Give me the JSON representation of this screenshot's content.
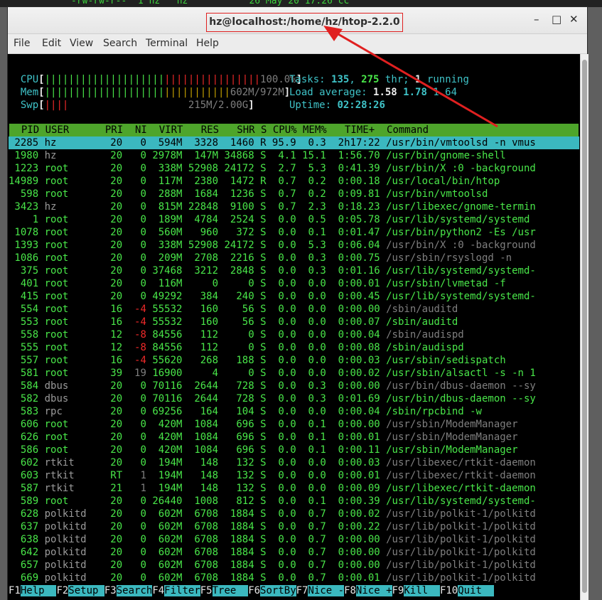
{
  "background_terminal": {
    "peek_text": "-rw-rw-r--  1 hz   hz           26 May 20 17:26 cc"
  },
  "window": {
    "title": "hz@localhost:/home/hz/htop-2.2.0",
    "buttons": {
      "minimize": "–",
      "maximize": "□",
      "close": "✕"
    }
  },
  "menubar": {
    "items": [
      "File",
      "Edit",
      "View",
      "Search",
      "Terminal",
      "Help"
    ]
  },
  "meters": {
    "cpu": {
      "label": "CPU",
      "bars_green": "||||||||||||||||||||",
      "bars_red": "||||||||||||||||",
      "value": "100.0%"
    },
    "mem": {
      "label": "Mem",
      "bars_green": "||||||||||||||||||||",
      "bars_yellow": "|||||||||||",
      "value": "602M/972M"
    },
    "swp": {
      "label": "Swp",
      "bars_red": "||||",
      "value": "215M/2.00G"
    }
  },
  "summary": {
    "tasks_label": "Tasks: ",
    "tasks_count": "135",
    "thr_count": "275",
    "thr_label": " thr; ",
    "running_count": "1",
    "running_label": " running",
    "load_label": "Load average: ",
    "load_1": "1.58",
    "load_5": "1.78",
    "load_15": "1.64",
    "uptime_label": "Uptime: ",
    "uptime_value": "02:28:26"
  },
  "columns": {
    "header": "  PID USER      PRI  NI  VIRT   RES   SHR S CPU% MEM%   TIME+  Command"
  },
  "processes": [
    {
      "pid": "2285",
      "user": "hz",
      "pri": "20",
      "ni": "0",
      "virt": "594M",
      "res": "3328",
      "shr": "1460",
      "s": "R",
      "cpu": "95.9",
      "mem": "0.3",
      "time": "2h17:22",
      "cmd": "/usr/bin/vmtoolsd -n vmus",
      "selected": true
    },
    {
      "pid": "1980",
      "user": "hz",
      "pri": "20",
      "ni": "0",
      "virt": "2978M",
      "res": "147M",
      "shr": "34868",
      "s": "S",
      "cpu": "4.1",
      "mem": "15.1",
      "time": "1:56.70",
      "cmd": "/usr/bin/gnome-shell"
    },
    {
      "pid": "1223",
      "user": "root",
      "pri": "20",
      "ni": "0",
      "virt": "338M",
      "res": "52908",
      "shr": "24172",
      "s": "S",
      "cpu": "2.7",
      "mem": "5.3",
      "time": "0:41.39",
      "cmd": "/usr/bin/X :0 -background"
    },
    {
      "pid": "14989",
      "user": "root",
      "pri": "20",
      "ni": "0",
      "virt": "117M",
      "res": "2380",
      "shr": "1472",
      "s": "R",
      "cpu": "0.7",
      "mem": "0.2",
      "time": "0:00.18",
      "cmd": "/usr/local/bin/htop"
    },
    {
      "pid": "598",
      "user": "root",
      "pri": "20",
      "ni": "0",
      "virt": "288M",
      "res": "1684",
      "shr": "1236",
      "s": "S",
      "cpu": "0.7",
      "mem": "0.2",
      "time": "0:09.81",
      "cmd": "/usr/bin/vmtoolsd"
    },
    {
      "pid": "3423",
      "user": "hz",
      "pri": "20",
      "ni": "0",
      "virt": "815M",
      "res": "22848",
      "shr": "9100",
      "s": "S",
      "cpu": "0.7",
      "mem": "2.3",
      "time": "0:18.23",
      "cmd": "/usr/libexec/gnome-termin"
    },
    {
      "pid": "1",
      "user": "root",
      "pri": "20",
      "ni": "0",
      "virt": "189M",
      "res": "4784",
      "shr": "2524",
      "s": "S",
      "cpu": "0.0",
      "mem": "0.5",
      "time": "0:05.78",
      "cmd": "/usr/lib/systemd/systemd"
    },
    {
      "pid": "1078",
      "user": "root",
      "pri": "20",
      "ni": "0",
      "virt": "560M",
      "res": "960",
      "shr": "372",
      "s": "S",
      "cpu": "0.0",
      "mem": "0.1",
      "time": "0:01.47",
      "cmd": "/usr/bin/python2 -Es /usr"
    },
    {
      "pid": "1393",
      "user": "root",
      "pri": "20",
      "ni": "0",
      "virt": "338M",
      "res": "52908",
      "shr": "24172",
      "s": "S",
      "cpu": "0.0",
      "mem": "5.3",
      "time": "0:06.04",
      "cmd": "/usr/bin/X :0 -background",
      "dim_cmd": true
    },
    {
      "pid": "1086",
      "user": "root",
      "pri": "20",
      "ni": "0",
      "virt": "209M",
      "res": "2708",
      "shr": "2216",
      "s": "S",
      "cpu": "0.0",
      "mem": "0.3",
      "time": "0:00.75",
      "cmd": "/usr/sbin/rsyslogd -n",
      "dim_cmd": true
    },
    {
      "pid": "375",
      "user": "root",
      "pri": "20",
      "ni": "0",
      "virt": "37468",
      "res": "3212",
      "shr": "2848",
      "s": "S",
      "cpu": "0.0",
      "mem": "0.3",
      "time": "0:01.16",
      "cmd": "/usr/lib/systemd/systemd-"
    },
    {
      "pid": "401",
      "user": "root",
      "pri": "20",
      "ni": "0",
      "virt": "116M",
      "res": "0",
      "shr": "0",
      "s": "S",
      "cpu": "0.0",
      "mem": "0.0",
      "time": "0:00.01",
      "cmd": "/usr/sbin/lvmetad -f"
    },
    {
      "pid": "415",
      "user": "root",
      "pri": "20",
      "ni": "0",
      "virt": "49292",
      "res": "384",
      "shr": "240",
      "s": "S",
      "cpu": "0.0",
      "mem": "0.0",
      "time": "0:00.45",
      "cmd": "/usr/lib/systemd/systemd-"
    },
    {
      "pid": "554",
      "user": "root",
      "pri": "16",
      "ni": "-4",
      "virt": "55532",
      "res": "160",
      "shr": "56",
      "s": "S",
      "cpu": "0.0",
      "mem": "0.0",
      "time": "0:00.00",
      "cmd": "/sbin/auditd",
      "dim_cmd": true
    },
    {
      "pid": "553",
      "user": "root",
      "pri": "16",
      "ni": "-4",
      "virt": "55532",
      "res": "160",
      "shr": "56",
      "s": "S",
      "cpu": "0.0",
      "mem": "0.0",
      "time": "0:00.07",
      "cmd": "/sbin/auditd"
    },
    {
      "pid": "558",
      "user": "root",
      "pri": "12",
      "ni": "-8",
      "virt": "84556",
      "res": "112",
      "shr": "0",
      "s": "S",
      "cpu": "0.0",
      "mem": "0.0",
      "time": "0:00.04",
      "cmd": "/sbin/audispd",
      "dim_cmd": true
    },
    {
      "pid": "555",
      "user": "root",
      "pri": "12",
      "ni": "-8",
      "virt": "84556",
      "res": "112",
      "shr": "0",
      "s": "S",
      "cpu": "0.0",
      "mem": "0.0",
      "time": "0:00.08",
      "cmd": "/sbin/audispd"
    },
    {
      "pid": "557",
      "user": "root",
      "pri": "16",
      "ni": "-4",
      "virt": "55620",
      "res": "268",
      "shr": "188",
      "s": "S",
      "cpu": "0.0",
      "mem": "0.0",
      "time": "0:00.03",
      "cmd": "/usr/sbin/sedispatch"
    },
    {
      "pid": "581",
      "user": "root",
      "pri": "39",
      "ni": "19",
      "virt": "16900",
      "res": "4",
      "shr": "0",
      "s": "S",
      "cpu": "0.0",
      "mem": "0.0",
      "time": "0:00.02",
      "cmd": "/usr/sbin/alsactl -s -n 1"
    },
    {
      "pid": "584",
      "user": "dbus",
      "pri": "20",
      "ni": "0",
      "virt": "70116",
      "res": "2644",
      "shr": "728",
      "s": "S",
      "cpu": "0.0",
      "mem": "0.3",
      "time": "0:00.00",
      "cmd": "/usr/bin/dbus-daemon --sy",
      "dim_cmd": true
    },
    {
      "pid": "582",
      "user": "dbus",
      "pri": "20",
      "ni": "0",
      "virt": "70116",
      "res": "2644",
      "shr": "728",
      "s": "S",
      "cpu": "0.0",
      "mem": "0.3",
      "time": "0:01.69",
      "cmd": "/usr/bin/dbus-daemon --sy"
    },
    {
      "pid": "583",
      "user": "rpc",
      "pri": "20",
      "ni": "0",
      "virt": "69256",
      "res": "164",
      "shr": "104",
      "s": "S",
      "cpu": "0.0",
      "mem": "0.0",
      "time": "0:00.04",
      "cmd": "/sbin/rpcbind -w"
    },
    {
      "pid": "606",
      "user": "root",
      "pri": "20",
      "ni": "0",
      "virt": "420M",
      "res": "1084",
      "shr": "696",
      "s": "S",
      "cpu": "0.0",
      "mem": "0.1",
      "time": "0:00.00",
      "cmd": "/usr/sbin/ModemManager",
      "dim_cmd": true
    },
    {
      "pid": "626",
      "user": "root",
      "pri": "20",
      "ni": "0",
      "virt": "420M",
      "res": "1084",
      "shr": "696",
      "s": "S",
      "cpu": "0.0",
      "mem": "0.1",
      "time": "0:00.01",
      "cmd": "/usr/sbin/ModemManager",
      "dim_cmd": true
    },
    {
      "pid": "586",
      "user": "root",
      "pri": "20",
      "ni": "0",
      "virt": "420M",
      "res": "1084",
      "shr": "696",
      "s": "S",
      "cpu": "0.0",
      "mem": "0.1",
      "time": "0:00.11",
      "cmd": "/usr/sbin/ModemManager"
    },
    {
      "pid": "602",
      "user": "rtkit",
      "pri": "20",
      "ni": "0",
      "virt": "194M",
      "res": "148",
      "shr": "132",
      "s": "S",
      "cpu": "0.0",
      "mem": "0.0",
      "time": "0:00.03",
      "cmd": "/usr/libexec/rtkit-daemon",
      "dim_cmd": true
    },
    {
      "pid": "603",
      "user": "rtkit",
      "pri": "RT",
      "ni": "1",
      "virt": "194M",
      "res": "148",
      "shr": "132",
      "s": "S",
      "cpu": "0.0",
      "mem": "0.0",
      "time": "0:00.01",
      "cmd": "/usr/libexec/rtkit-daemon",
      "dim_cmd": true
    },
    {
      "pid": "587",
      "user": "rtkit",
      "pri": "21",
      "ni": "1",
      "virt": "194M",
      "res": "148",
      "shr": "132",
      "s": "S",
      "cpu": "0.0",
      "mem": "0.0",
      "time": "0:00.09",
      "cmd": "/usr/libexec/rtkit-daemon"
    },
    {
      "pid": "589",
      "user": "root",
      "pri": "20",
      "ni": "0",
      "virt": "26440",
      "res": "1008",
      "shr": "812",
      "s": "S",
      "cpu": "0.0",
      "mem": "0.1",
      "time": "0:00.39",
      "cmd": "/usr/lib/systemd/systemd-"
    },
    {
      "pid": "628",
      "user": "polkitd",
      "pri": "20",
      "ni": "0",
      "virt": "602M",
      "res": "6708",
      "shr": "1884",
      "s": "S",
      "cpu": "0.0",
      "mem": "0.7",
      "time": "0:00.02",
      "cmd": "/usr/lib/polkit-1/polkitd",
      "dim_cmd": true
    },
    {
      "pid": "637",
      "user": "polkitd",
      "pri": "20",
      "ni": "0",
      "virt": "602M",
      "res": "6708",
      "shr": "1884",
      "s": "S",
      "cpu": "0.0",
      "mem": "0.7",
      "time": "0:00.22",
      "cmd": "/usr/lib/polkit-1/polkitd",
      "dim_cmd": true
    },
    {
      "pid": "638",
      "user": "polkitd",
      "pri": "20",
      "ni": "0",
      "virt": "602M",
      "res": "6708",
      "shr": "1884",
      "s": "S",
      "cpu": "0.0",
      "mem": "0.7",
      "time": "0:00.00",
      "cmd": "/usr/lib/polkit-1/polkitd",
      "dim_cmd": true
    },
    {
      "pid": "642",
      "user": "polkitd",
      "pri": "20",
      "ni": "0",
      "virt": "602M",
      "res": "6708",
      "shr": "1884",
      "s": "S",
      "cpu": "0.0",
      "mem": "0.7",
      "time": "0:00.00",
      "cmd": "/usr/lib/polkit-1/polkitd",
      "dim_cmd": true
    },
    {
      "pid": "657",
      "user": "polkitd",
      "pri": "20",
      "ni": "0",
      "virt": "602M",
      "res": "6708",
      "shr": "1884",
      "s": "S",
      "cpu": "0.0",
      "mem": "0.7",
      "time": "0:00.00",
      "cmd": "/usr/lib/polkit-1/polkitd",
      "dim_cmd": true
    },
    {
      "pid": "669",
      "user": "polkitd",
      "pri": "20",
      "ni": "0",
      "virt": "602M",
      "res": "6708",
      "shr": "1884",
      "s": "S",
      "cpu": "0.0",
      "mem": "0.7",
      "time": "0:00.01",
      "cmd": "/usr/lib/polkit-1/polkitd",
      "dim_cmd": true
    }
  ],
  "function_keys": [
    {
      "key": "F1",
      "label": "Help  "
    },
    {
      "key": "F2",
      "label": "Setup "
    },
    {
      "key": "F3",
      "label": "Search"
    },
    {
      "key": "F4",
      "label": "Filter"
    },
    {
      "key": "F5",
      "label": "Tree  "
    },
    {
      "key": "F6",
      "label": "SortBy"
    },
    {
      "key": "F7",
      "label": "Nice -"
    },
    {
      "key": "F8",
      "label": "Nice +"
    },
    {
      "key": "F9",
      "label": "Kill  "
    },
    {
      "key": "F10",
      "label": "Quit  "
    }
  ],
  "colors": {
    "annotation": "#e02020",
    "header_bg": "#4ea52b",
    "selected_bg": "#3bb8bf"
  }
}
